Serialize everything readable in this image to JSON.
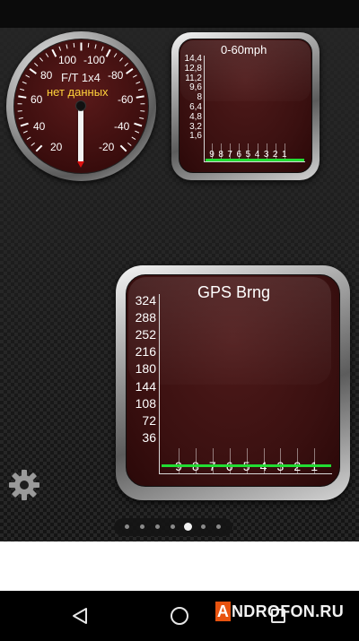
{
  "dial_gauge": {
    "title": "F/T 1x4",
    "status": "нет данных",
    "scale_left": [
      "100",
      "80",
      "60",
      "40",
      "20"
    ],
    "scale_right": [
      "-100",
      "-80",
      "-60",
      "-40",
      "-20"
    ]
  },
  "chart_small": {
    "title": "0-60mph",
    "y_ticks": [
      "14,4",
      "12,8",
      "11,2",
      "9,6",
      "8",
      "6,4",
      "4,8",
      "3,2",
      "1,6"
    ],
    "x_ticks": [
      "9",
      "8",
      "7",
      "6",
      "5",
      "4",
      "3",
      "2",
      "1"
    ],
    "line_color": "#22dd33"
  },
  "chart_large": {
    "title": "GPS Brng",
    "y_ticks": [
      "324",
      "288",
      "252",
      "216",
      "180",
      "144",
      "108",
      "72",
      "36"
    ],
    "x_ticks": [
      "9",
      "8",
      "7",
      "6",
      "5",
      "4",
      "3",
      "2",
      "1"
    ],
    "line_color": "#22dd33"
  },
  "chart_data": [
    {
      "type": "line",
      "title": "0-60mph",
      "x": [
        "9",
        "8",
        "7",
        "6",
        "5",
        "4",
        "3",
        "2",
        "1"
      ],
      "y_ticks": [
        "14,4",
        "12,8",
        "11,2",
        "9,6",
        "8",
        "6,4",
        "4,8",
        "3,2",
        "1,6"
      ],
      "series": [
        {
          "values": [
            0,
            0,
            0,
            0,
            0,
            0,
            0,
            0,
            0
          ]
        }
      ],
      "ylim": [
        0,
        16
      ]
    },
    {
      "type": "line",
      "title": "GPS Brng",
      "x": [
        "9",
        "8",
        "7",
        "6",
        "5",
        "4",
        "3",
        "2",
        "1"
      ],
      "y_ticks": [
        "324",
        "288",
        "252",
        "216",
        "180",
        "144",
        "108",
        "72",
        "36"
      ],
      "series": [
        {
          "values": [
            0,
            0,
            0,
            0,
            0,
            0,
            0,
            0,
            0
          ]
        }
      ],
      "ylim": [
        0,
        360
      ]
    }
  ],
  "pager": {
    "page_count": 7,
    "active_index": 4
  },
  "nav": {
    "back": "back-icon",
    "home": "home-icon",
    "recents": "recents-icon"
  },
  "watermark": {
    "boxed_letter": "A",
    "text": "NDROFON.RU"
  },
  "colors": {
    "accent_green": "#22dd33",
    "gauge_face": "#3a1010",
    "needle_tip": "#dd1111",
    "watermark_orange": "#e8530f"
  }
}
